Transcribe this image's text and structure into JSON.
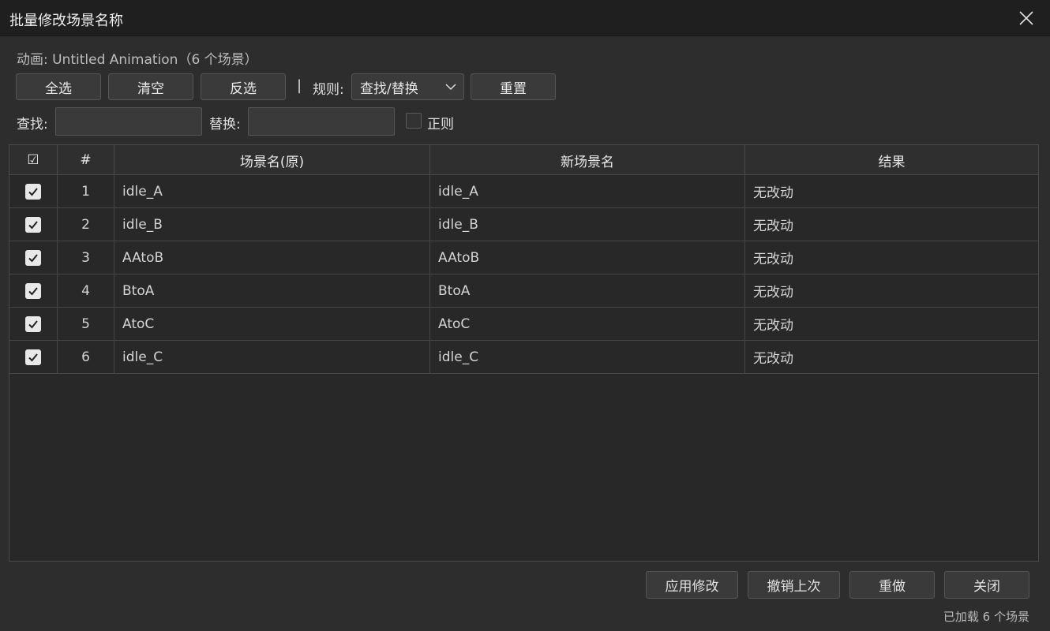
{
  "window": {
    "title": "批量修改场景名称"
  },
  "subtitle": "动画: Untitled Animation（6 个场景）",
  "toolbar": {
    "select_all": "全选",
    "clear": "清空",
    "invert": "反选",
    "separator": "|",
    "rule_label": "规则:",
    "rule_value": "查找/替换",
    "reset": "重置"
  },
  "find": {
    "label": "查找:",
    "value": ""
  },
  "replace": {
    "label": "替换:",
    "value": ""
  },
  "regex": {
    "label": "正则",
    "checked": false
  },
  "table": {
    "headers": {
      "check": "☑",
      "index": "#",
      "original": "场景名(原)",
      "new": "新场景名",
      "result": "结果"
    },
    "rows": [
      {
        "index": "1",
        "original": "idle_A",
        "new": "idle_A",
        "result": "无改动",
        "checked": true
      },
      {
        "index": "2",
        "original": "idle_B",
        "new": "idle_B",
        "result": "无改动",
        "checked": true
      },
      {
        "index": "3",
        "original": "AAtoB",
        "new": "AAtoB",
        "result": "无改动",
        "checked": true
      },
      {
        "index": "4",
        "original": "BtoA",
        "new": "BtoA",
        "result": "无改动",
        "checked": true
      },
      {
        "index": "5",
        "original": "AtoC",
        "new": "AtoC",
        "result": "无改动",
        "checked": true
      },
      {
        "index": "6",
        "original": "idle_C",
        "new": "idle_C",
        "result": "无改动",
        "checked": true
      }
    ]
  },
  "footer": {
    "apply": "应用修改",
    "undo": "撤销上次",
    "redo": "重做",
    "close": "关闭",
    "status": "已加载 6 个场景"
  },
  "icons": {
    "close": "close-icon",
    "chevron": "chevron-down-icon",
    "check": "check-icon"
  }
}
